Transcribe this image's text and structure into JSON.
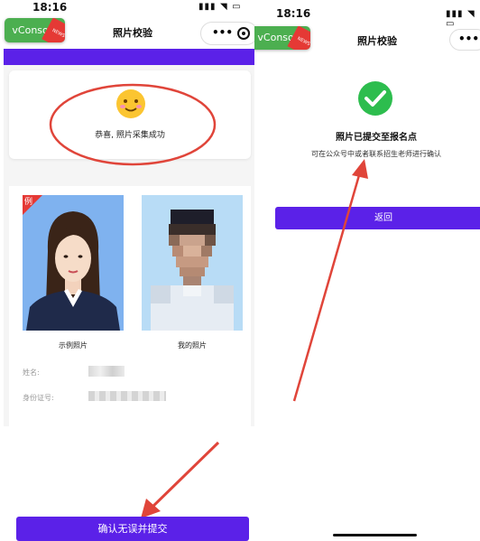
{
  "left": {
    "status": {
      "time": "18:16",
      "icons": "▮▮▮ ◥ ▭"
    },
    "vconsole": {
      "label": "vConsole",
      "badge": "NEWS"
    },
    "title": "照片校验",
    "more": "•••",
    "success_message": "恭喜, 照片采集成功",
    "sample_badge": "例",
    "sample_caption": "示例照片",
    "my_caption": "我的照片",
    "name_label": "姓名:",
    "id_label": "身份证号:",
    "submit_label": "确认无误并提交"
  },
  "right": {
    "status": {
      "time": "18:16",
      "icons": "▮▮▮ ◥ ▭"
    },
    "vconsole": {
      "label": "vConsole",
      "badge": "NEWS"
    },
    "title": "照片校验",
    "more": "•••",
    "heading": "照片已提交至报名点",
    "subtext": "可在公众号中或者联系招生老师进行确认",
    "back_label": "返回"
  },
  "colors": {
    "accent": "#5b21e8",
    "success": "#2dbd4e",
    "annotation": "#e0453a",
    "vconsole": "#4caf50",
    "photo_bg": "#7fb2ef"
  }
}
